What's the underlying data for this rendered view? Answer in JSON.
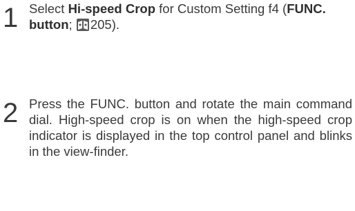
{
  "step1": {
    "number": "1",
    "text_before": "Select ",
    "bold_term": "Hi-speed Crop",
    "text_middle": " for Custom Setting f4 (",
    "bold_button": "FUNC. button",
    "text_semicolon": "; ",
    "page_ref": "205",
    "text_end": ")."
  },
  "step2": {
    "number": "2",
    "text": "Press the FUNC. button and rotate the main command dial.  High-speed crop is on when the high-speed crop indicator is displayed in the top control panel and blinks in the view-finder."
  },
  "icons": {
    "page_reference": "page-reference-icon",
    "icon_color": "#5a5a5a"
  }
}
